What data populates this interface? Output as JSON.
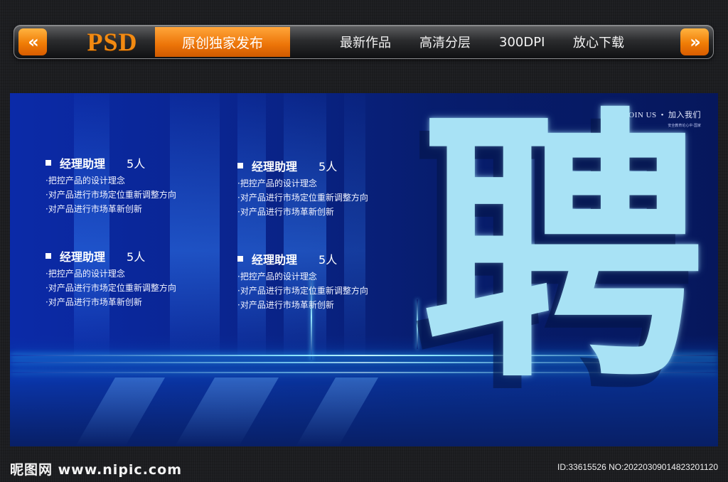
{
  "nav": {
    "left_arrow": "«",
    "right_arrow": "»",
    "logo": "PSD",
    "highlight": "原创独家发布",
    "links": [
      "最新作品",
      "高清分层",
      "300DPI",
      "放心下载"
    ]
  },
  "banner": {
    "join_main": "JOIN US",
    "join_dot": "•",
    "join_cn": "加入我们",
    "join_sub": "安全教育论心中·国家",
    "big_char": "聘",
    "blocks": [
      {
        "title": "经理助理",
        "count": "5人",
        "items": [
          "·把控产品的设计理念",
          "·对产品进行市场定位重新调整方向",
          "·对产品进行市场革新创新"
        ]
      },
      {
        "title": "经理助理",
        "count": "5人",
        "items": [
          "·把控产品的设计理念",
          "·对产品进行市场定位重新调整方向",
          "·对产品进行市场革新创新"
        ]
      },
      {
        "title": "经理助理",
        "count": "5人",
        "items": [
          "·把控产品的设计理念",
          "·对产品进行市场定位重新调整方向",
          "·对产品进行市场革新创新"
        ]
      },
      {
        "title": "经理助理",
        "count": "5人",
        "items": [
          "·把控产品的设计理念",
          "·对产品进行市场定位重新调整方向",
          "·对产品进行市场革新创新"
        ]
      }
    ]
  },
  "footer": {
    "logo": "昵图网 www.nipic.com",
    "id": "ID:33615526 NO:20220309014823201120"
  },
  "colors": {
    "accent_orange": "#f07d06",
    "banner_blue": "#0a2590",
    "char_cyan": "#a8e2f5"
  }
}
